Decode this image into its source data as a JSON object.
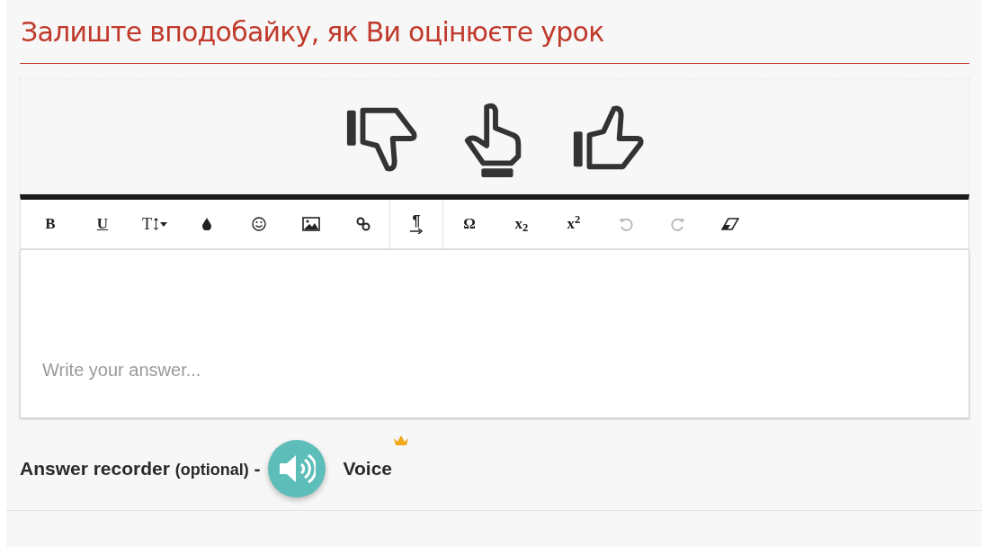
{
  "title": "Залиште вподобайку, як Ви оцінюєте урок",
  "reactions": [
    {
      "kind": "dislike",
      "selected": false
    },
    {
      "kind": "neutral",
      "selected": false
    },
    {
      "kind": "like",
      "selected": false
    }
  ],
  "toolbar": {
    "groups": [
      [
        {
          "kind": "bold",
          "label": "B"
        },
        {
          "kind": "underline",
          "label": "U"
        },
        {
          "kind": "fontsize",
          "label": "T"
        },
        {
          "kind": "drop"
        },
        {
          "kind": "smiley"
        },
        {
          "kind": "image"
        },
        {
          "kind": "link"
        }
      ],
      [
        {
          "kind": "paragraph",
          "label": "¶"
        }
      ],
      [
        {
          "kind": "bold",
          "label": "Ω"
        },
        {
          "kind": "bold",
          "label": "x$_{2}$"
        },
        {
          "kind": "bold",
          "label": "x$^{2}$"
        },
        {
          "kind": "undo",
          "disabled": true
        },
        {
          "kind": "redo",
          "disabled": true
        },
        {
          "kind": "eraser"
        }
      ]
    ]
  },
  "editor": {
    "placeholder": "Write your answer..."
  },
  "recorder": {
    "label": "Answer recorder",
    "note": "(optional)",
    "dash": "-",
    "voice": "Voice",
    "premium": true
  }
}
